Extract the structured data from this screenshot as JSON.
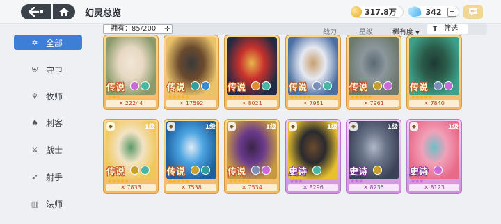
{
  "header": {
    "title": "幻灵总览",
    "gold_amount": "317.8万",
    "gem_amount": "342"
  },
  "sidebar": {
    "items": [
      {
        "label": "全部",
        "icon": "star-of-david-icon",
        "active": true
      },
      {
        "label": "守卫",
        "icon": "shield-icon",
        "active": false
      },
      {
        "label": "牧师",
        "icon": "wings-icon",
        "active": false
      },
      {
        "label": "刺客",
        "icon": "assassin-icon",
        "active": false
      },
      {
        "label": "战士",
        "icon": "warrior-icon",
        "active": false
      },
      {
        "label": "射手",
        "icon": "bow-icon",
        "active": false
      },
      {
        "label": "法师",
        "icon": "book-icon",
        "active": false
      }
    ]
  },
  "toolbar": {
    "owned": "拥有：85/200",
    "power_label": "战力",
    "level_label": "星级",
    "rarity_label": "稀有度",
    "filter_label": "筛选"
  },
  "cards": [
    {
      "rarity": "传说",
      "tier": "gold",
      "level": "",
      "stars": 3,
      "power": "22244",
      "badges": [
        "#c86ad8",
        "#47b7a5"
      ],
      "art": [
        "#e7d8c2",
        "#8a9a6a",
        "#f1e7d6"
      ]
    },
    {
      "rarity": "传说",
      "tier": "gold",
      "level": "",
      "stars": 5,
      "power": "17592",
      "badges": [
        "#2e9e9e",
        "#3a8bd4"
      ],
      "art": [
        "#6b4a2e",
        "#e8c36a",
        "#3a3a3a"
      ]
    },
    {
      "rarity": "传说",
      "tier": "gold",
      "level": "",
      "stars": 5,
      "power": "8021",
      "badges": [
        "#e88a2e",
        "#47b7a5"
      ],
      "art": [
        "#c8312c",
        "#222a44",
        "#e9b54c"
      ]
    },
    {
      "rarity": "传说",
      "tier": "gold",
      "level": "",
      "stars": 5,
      "power": "7981",
      "badges": [
        "#7a8fb8",
        "#47b7a5"
      ],
      "art": [
        "#e6e9f2",
        "#4a6fa3",
        "#c9a070"
      ]
    },
    {
      "rarity": "传说",
      "tier": "gold",
      "level": "",
      "stars": 5,
      "power": "7961",
      "badges": [
        "#c8a02e",
        "#c86ad8"
      ],
      "art": [
        "#8c969c",
        "#6c7a6e",
        "#5a6a74"
      ]
    },
    {
      "rarity": "传说",
      "tier": "gold",
      "level": "",
      "stars": 5,
      "power": "7840",
      "badges": [
        "#7a8fb8",
        "#c86ad8"
      ],
      "art": [
        "#2b5c4a",
        "#3ea08a",
        "#1e3a34"
      ]
    },
    {
      "rarity": "传说",
      "tier": "gold",
      "level": "1级",
      "stars": 5,
      "power": "7833",
      "badges": [
        "#c8a02e",
        "#47b7a5"
      ],
      "art": [
        "#f2e3c4",
        "#f0c85a",
        "#5a9a6a"
      ]
    },
    {
      "rarity": "传说",
      "tier": "gold",
      "level": "1级",
      "stars": 5,
      "power": "7538",
      "badges": [
        "#c8a02e",
        "#2e9e9e"
      ],
      "art": [
        "#4aa3e0",
        "#1e5fa0",
        "#dfeaf6"
      ]
    },
    {
      "rarity": "传说",
      "tier": "gold",
      "level": "1级",
      "stars": 5,
      "power": "7534",
      "badges": [
        "#7a8fb8",
        "#c86ad8"
      ],
      "art": [
        "#6a3a8c",
        "#c89a3e",
        "#3a2448"
      ]
    },
    {
      "rarity": "史诗",
      "tier": "purple",
      "level": "1级",
      "stars": 3,
      "power": "8296",
      "badges": [
        "#47b7a5"
      ],
      "art": [
        "#2a2a2e",
        "#e8c02e",
        "#6a4a2e"
      ]
    },
    {
      "rarity": "史诗",
      "tier": "purple",
      "level": "1级",
      "stars": 3,
      "power": "8235",
      "badges": [
        "#c8a02e"
      ],
      "art": [
        "#6a7488",
        "#3a4258",
        "#b0b8c8"
      ]
    },
    {
      "rarity": "史诗",
      "tier": "purple",
      "level": "1级",
      "stars": 3,
      "power": "8123",
      "badges": [
        "#c86ad8"
      ],
      "art": [
        "#f2a0b8",
        "#e86a8a",
        "#6ac0c8"
      ]
    }
  ]
}
